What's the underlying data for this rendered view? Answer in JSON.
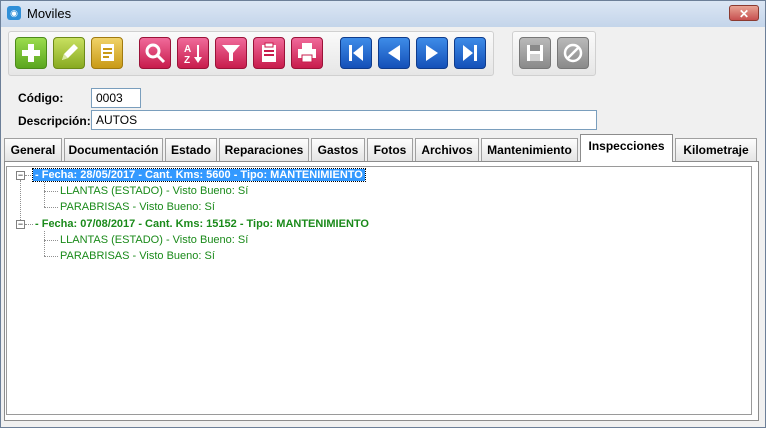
{
  "window": {
    "title": "Moviles",
    "close_label": "✕"
  },
  "toolbar": {
    "buttons": [
      {
        "name": "add-button",
        "icon": "plus-icon"
      },
      {
        "name": "edit-button",
        "icon": "pencil-icon"
      },
      {
        "name": "copy-button",
        "icon": "document-icon"
      },
      {
        "name": "search-button",
        "icon": "magnifier-icon"
      },
      {
        "name": "sort-button",
        "icon": "sort-az-icon"
      },
      {
        "name": "filter-button",
        "icon": "funnel-icon"
      },
      {
        "name": "report-button",
        "icon": "clipboard-icon"
      },
      {
        "name": "print-button",
        "icon": "printer-icon"
      },
      {
        "name": "first-button",
        "icon": "first-icon"
      },
      {
        "name": "prev-button",
        "icon": "prev-icon"
      },
      {
        "name": "next-button",
        "icon": "next-icon"
      },
      {
        "name": "last-button",
        "icon": "last-icon"
      },
      {
        "name": "save-button",
        "icon": "floppy-icon"
      },
      {
        "name": "cancel-button",
        "icon": "cancel-icon"
      }
    ]
  },
  "form": {
    "codigo_label": "Código:",
    "codigo_value": "0003",
    "descripcion_label": "Descripción:",
    "descripcion_value": "AUTOS"
  },
  "tabs": [
    "General",
    "Documentación",
    "Estado",
    "Reparaciones",
    "Gastos",
    "Fotos",
    "Archivos",
    "Mantenimiento",
    "Inspecciones",
    "Kilometraje"
  ],
  "active_tab": "Inspecciones",
  "tree": [
    {
      "label": "- Fecha: 28/05/2017 - Cant. Kms: 5600 - Tipo: MANTENIMIENTO",
      "selected": true,
      "children": [
        "LLANTAS (ESTADO) - Visto Bueno: Sí",
        "PARABRISAS - Visto Bueno: Sí"
      ]
    },
    {
      "label": "- Fecha: 07/08/2017 - Cant. Kms: 15152 - Tipo: MANTENIMIENTO",
      "selected": false,
      "children": [
        "LLANTAS (ESTADO) - Visto Bueno: Sí",
        "PARABRISAS - Visto Bueno: Sí"
      ]
    }
  ],
  "colors": {
    "tree_text": "#1a8a1a",
    "selection": "#3399ff",
    "titlebar": "#c4d5ea"
  }
}
